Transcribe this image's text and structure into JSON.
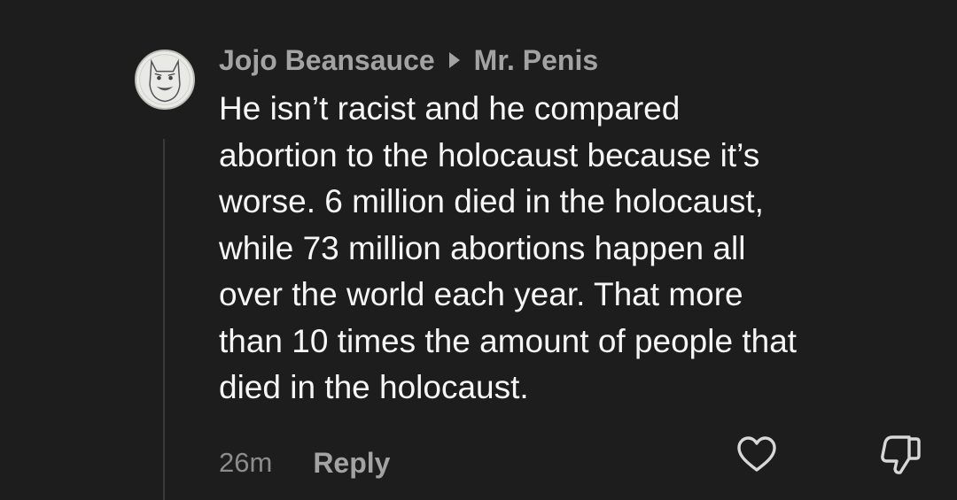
{
  "comment": {
    "author": "Jojo Beansauce",
    "reply_to": "Mr. Penis",
    "body_lines": [
      "He isn’t racist and he compared",
      "abortion to the holocaust because it’s",
      "worse. 6 million died in the holocaust,",
      "while 73 million abortions happen all",
      "over the world each year. That more",
      "than 10 times the amount of people that",
      "died in the holocaust."
    ],
    "timestamp": "26m",
    "reply_label": "Reply"
  },
  "icons": {
    "avatar": "cartoon-face-avatar",
    "reply_arrow": "caret-right-icon",
    "like": "heart-outline-icon",
    "dislike": "thumbs-down-outline-icon"
  },
  "colors": {
    "background": "#1d1d1d",
    "body_text": "#f6f6f6",
    "muted_text": "#a3a3a3",
    "timestamp_text": "#8c8c8c",
    "icon_stroke": "#d8d8d8"
  }
}
